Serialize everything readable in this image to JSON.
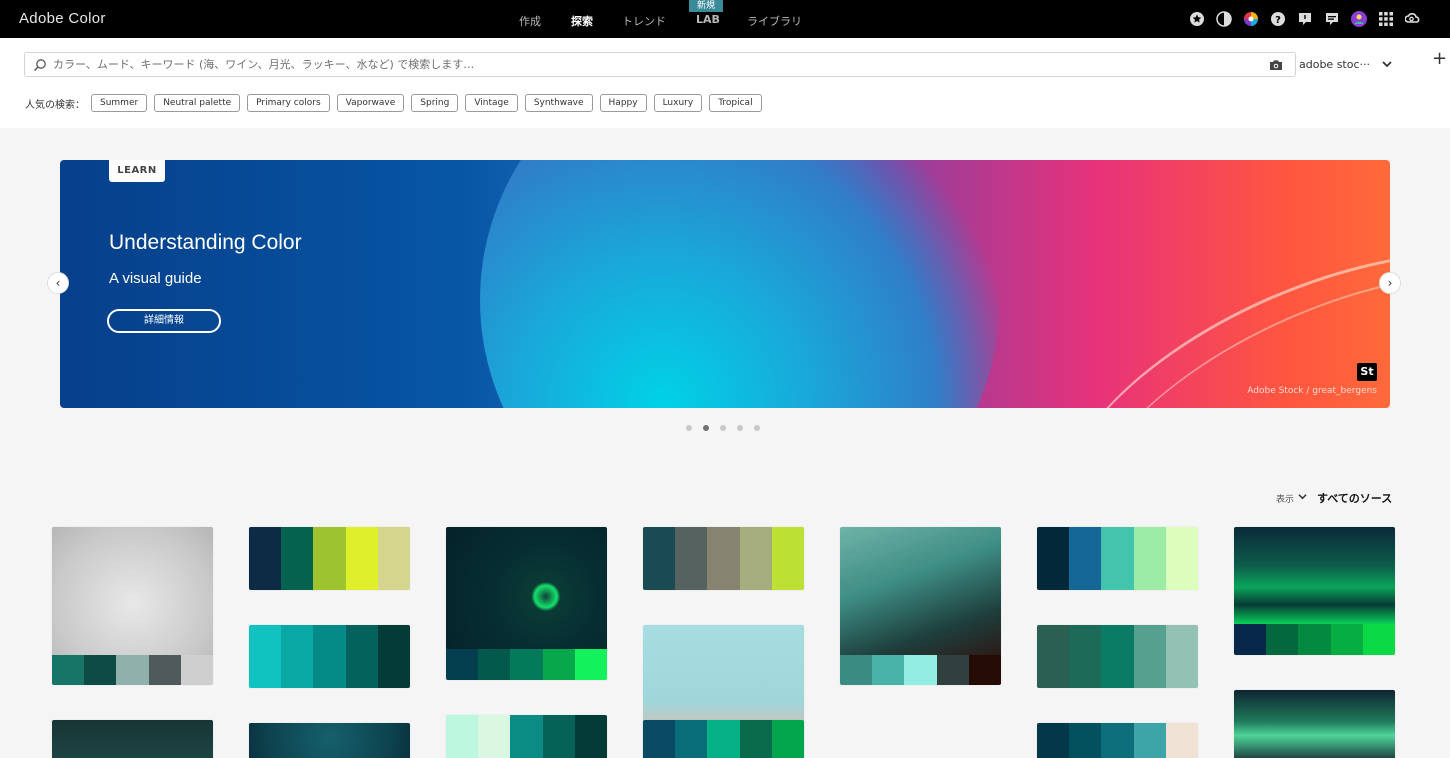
{
  "app": {
    "title": "Adobe Color"
  },
  "nav": {
    "items": [
      {
        "label": "作成",
        "active": false
      },
      {
        "label": "探索",
        "active": true
      },
      {
        "label": "トレンド",
        "active": false
      },
      {
        "label": "LAB",
        "active": false,
        "badge": "新規"
      },
      {
        "label": "ライブラリ",
        "active": false
      }
    ]
  },
  "header_icons": [
    "star-icon",
    "contrast-icon",
    "color-wheel-icon",
    "help-icon",
    "alert-icon",
    "feedback-icon",
    "user-avatar-icon",
    "apps-grid-icon",
    "creative-cloud-icon"
  ],
  "search": {
    "placeholder": "カラー、ムード、キーワード (海、ワイン、月光、ラッキー、水など) で検索します…",
    "value": "",
    "source": "adobe stoc···"
  },
  "popular": {
    "label": "人気の検索：",
    "tags": [
      "Summer",
      "Neutral palette",
      "Primary colors",
      "Vaporwave",
      "Spring",
      "Vintage",
      "Synthwave",
      "Happy",
      "Luxury",
      "Tropical"
    ]
  },
  "hero": {
    "tag": "LEARN",
    "title": "Understanding Color",
    "subtitle": "A visual guide",
    "button": "詳細情報",
    "logo": "St",
    "credit": "Adobe Stock /  great_bergens",
    "slide_count": 5,
    "active_slide": 2
  },
  "filter": {
    "view_label": "表示",
    "source_label": "すべてのソース"
  },
  "palettes": [
    {
      "type": "photo",
      "photo": "stool",
      "colors": [
        "#167567",
        "#0e4b44",
        "#8fb0ab",
        "#505a5a",
        "#cfcfcf"
      ]
    },
    {
      "type": "plain",
      "colors": [
        "#0d2b44",
        "#05624e",
        "#9dc42f",
        "#e0ef2c",
        "#d6d58e"
      ]
    },
    {
      "type": "plain",
      "colors": [
        "#10c3c1",
        "#0aa8a5",
        "#058b87",
        "#03625c",
        "#033c36"
      ]
    },
    {
      "type": "photo",
      "photo": "space",
      "colors": [
        "#033f4f",
        "#03594b",
        "#037b5b",
        "#07a84b",
        "#13f15d"
      ]
    },
    {
      "type": "plain",
      "colors": [
        "#1a4a52",
        "#56625f",
        "#868471",
        "#a5ad7c",
        "#bde034"
      ]
    },
    {
      "type": "photo",
      "photo": "wall",
      "colors": [
        "#0c6f68",
        "#46b7b0",
        "#9ee8e0",
        "#2a3e3e",
        "#1a1010"
      ]
    },
    {
      "type": "photo",
      "photo": "comic",
      "colors": [
        "#3a8c83",
        "#47b3a7",
        "#93ede2",
        "#2f403e",
        "#250c07"
      ]
    },
    {
      "type": "plain",
      "colors": [
        "#03283a",
        "#156896",
        "#43c4ad",
        "#9ceba6",
        "#ddfdbd"
      ]
    },
    {
      "type": "plain",
      "colors": [
        "#2b5f51",
        "#1c6a57",
        "#0a7c65",
        "#55a08f",
        "#93c2b4"
      ]
    },
    {
      "type": "photo",
      "photo": "aurora",
      "colors": [
        "#08284a",
        "#04683e",
        "#048a40",
        "#06ad42",
        "#0bda46"
      ]
    },
    {
      "type": "photo",
      "photo": "food",
      "colors": [
        "#1a3a3a",
        "#224444",
        "#2b5050",
        "#365a5a",
        "#406060"
      ]
    },
    {
      "type": "photo",
      "photo": "teal-texture",
      "colors": [
        "#0c3d48",
        "#0e4a55",
        "#0f5661",
        "#115e6a",
        "#136572"
      ]
    },
    {
      "type": "plain",
      "colors": [
        "#bdf7e0",
        "#daf7e2",
        "#0a8c84",
        "#046257",
        "#033b36"
      ]
    },
    {
      "type": "plain",
      "colors": [
        "#0b4a64",
        "#0a6d7a",
        "#03b185",
        "#0a6b4c",
        "#04a64d"
      ]
    },
    {
      "type": "plain",
      "colors": [
        "#03384b",
        "#03515e",
        "#0c6f7a",
        "#3da5a7",
        "#f0e3d6"
      ]
    },
    {
      "type": "photo",
      "photo": "aurora2",
      "colors": [
        "#0b2a33",
        "#17604f",
        "#29a277",
        "#50d394",
        "#d0f0d8"
      ]
    }
  ]
}
